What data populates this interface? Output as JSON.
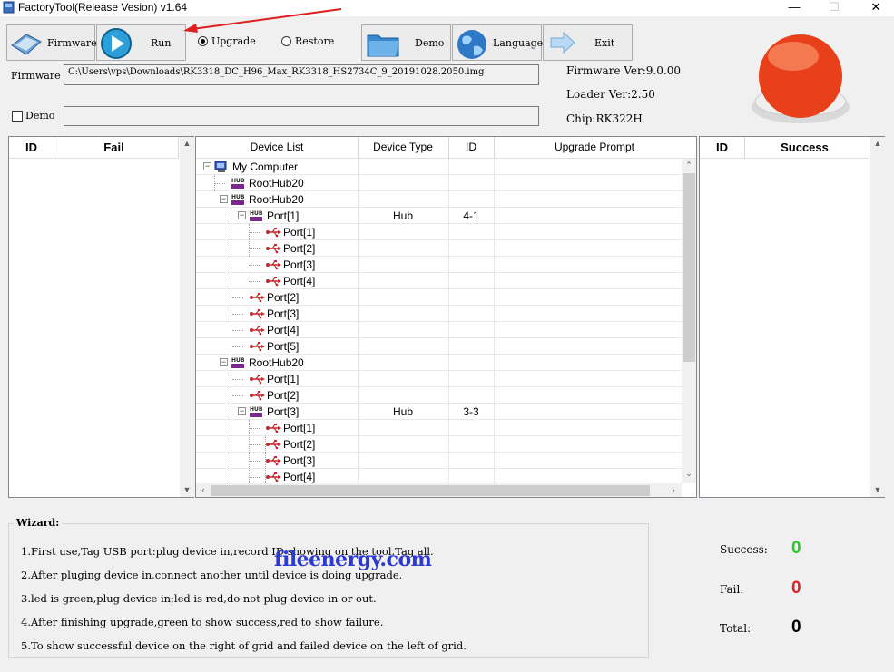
{
  "window": {
    "title": "FactoryTool(Release Vesion) v1.64",
    "minimize": "—",
    "maximize": "☐",
    "close": "✕"
  },
  "toolbar": {
    "firmware_label": "Firmware",
    "run_label": "Run",
    "upgrade_label": "Upgrade",
    "restore_label": "Restore",
    "mode_selected": "Upgrade",
    "demo_label": "Demo",
    "language_label": "Language",
    "exit_label": "Exit"
  },
  "firmware": {
    "label": "Firmware",
    "path": "C:\\Users\\vps\\Downloads\\RK3318_DC_H96_Max_RK3318_HS2734C_9_20191028.2050.img"
  },
  "demo": {
    "label": "Demo",
    "checked": false,
    "value": ""
  },
  "info": {
    "firmware_ver": "Firmware Ver:9.0.00",
    "loader_ver": "Loader Ver:2.50",
    "chip": "Chip:RK322H"
  },
  "status_led": {
    "color": "#e8401a"
  },
  "fail_panel": {
    "col_id": "ID",
    "col_fail": "Fail"
  },
  "success_panel": {
    "col_id": "ID",
    "col_success": "Success"
  },
  "device_list": {
    "columns": [
      "Device List",
      "Device Type",
      "ID",
      "Upgrade Prompt"
    ],
    "rows": [
      {
        "name": "My Computer",
        "type": "",
        "id": "",
        "icon": "computer-icon"
      },
      {
        "name": "RootHub20",
        "type": "",
        "id": "",
        "icon": "hub-icon"
      },
      {
        "name": "RootHub20",
        "type": "",
        "id": "",
        "icon": "hub-icon"
      },
      {
        "name": "Port[1]",
        "type": "Hub",
        "id": "4-1",
        "icon": "hub-icon"
      },
      {
        "name": "Port[1]",
        "type": "",
        "id": "",
        "icon": "usb-icon"
      },
      {
        "name": "Port[2]",
        "type": "",
        "id": "",
        "icon": "usb-icon"
      },
      {
        "name": "Port[3]",
        "type": "",
        "id": "",
        "icon": "usb-icon"
      },
      {
        "name": "Port[4]",
        "type": "",
        "id": "",
        "icon": "usb-icon"
      },
      {
        "name": "Port[2]",
        "type": "",
        "id": "",
        "icon": "usb-icon"
      },
      {
        "name": "Port[3]",
        "type": "",
        "id": "",
        "icon": "usb-icon"
      },
      {
        "name": "Port[4]",
        "type": "",
        "id": "",
        "icon": "usb-icon"
      },
      {
        "name": "Port[5]",
        "type": "",
        "id": "",
        "icon": "usb-icon"
      },
      {
        "name": "RootHub20",
        "type": "",
        "id": "",
        "icon": "hub-icon"
      },
      {
        "name": "Port[1]",
        "type": "",
        "id": "",
        "icon": "usb-icon"
      },
      {
        "name": "Port[2]",
        "type": "",
        "id": "",
        "icon": "usb-icon"
      },
      {
        "name": "Port[3]",
        "type": "Hub",
        "id": "3-3",
        "icon": "hub-icon"
      },
      {
        "name": "Port[1]",
        "type": "",
        "id": "",
        "icon": "usb-icon"
      },
      {
        "name": "Port[2]",
        "type": "",
        "id": "",
        "icon": "usb-icon"
      },
      {
        "name": "Port[3]",
        "type": "",
        "id": "",
        "icon": "usb-icon"
      },
      {
        "name": "Port[4]",
        "type": "",
        "id": "",
        "icon": "usb-icon"
      }
    ]
  },
  "wizard": {
    "title": "Wizard:",
    "lines": [
      "1.First use,Tag USB port:plug device in,record ID showing on the tool.Tag all.",
      "2.After pluging device in,connect another until device is doing upgrade.",
      "3.led is green,plug device in;led is red,do not plug device in or out.",
      "4.After finishing upgrade,green to show success,red to show failure.",
      "5.To show successful device on the right of grid and failed device on the left of grid."
    ]
  },
  "watermark": "fileenergy.com",
  "stats": {
    "success_label": "Success:",
    "success_value": "0",
    "success_color": "#22cc22",
    "fail_label": "Fail:",
    "fail_value": "0",
    "fail_color": "#dd2222",
    "total_label": "Total:",
    "total_value": "0"
  },
  "annotation_arrow_color": "#dd1f1f"
}
